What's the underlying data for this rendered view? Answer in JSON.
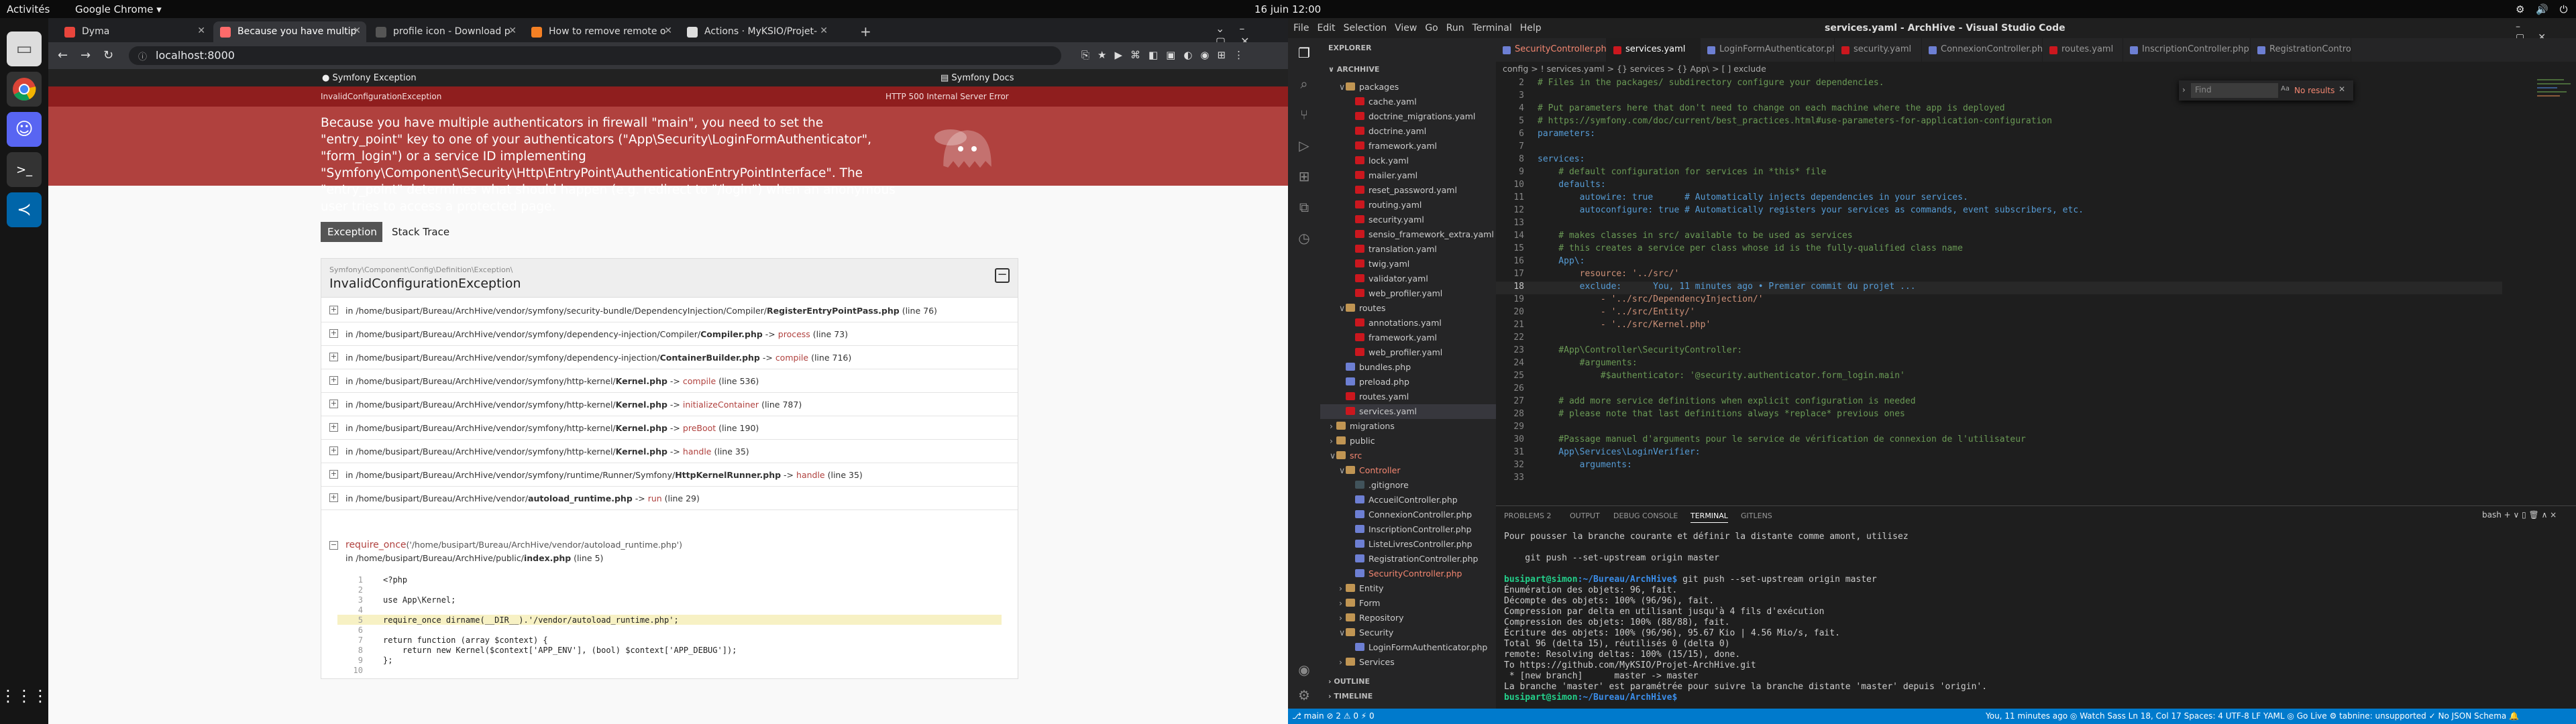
{
  "gnome": {
    "activities": "Activités",
    "app": "Google Chrome ▾",
    "clock": "16 juin  12:00"
  },
  "chrome": {
    "tabs": [
      {
        "label": "Dyma",
        "color": "#e8453c"
      },
      {
        "label": "Because you have multip",
        "color": "#ff6b6b"
      },
      {
        "label": "profile icon - Download p",
        "color": "#333"
      },
      {
        "label": "How to remove remote o",
        "color": "#f48024"
      },
      {
        "label": "Actions · MyKSIO/Projet-",
        "color": "#ddd"
      }
    ],
    "url": "localhost:8000"
  },
  "symfony": {
    "brand": "Symfony Exception",
    "docs": "Symfony Docs",
    "exception_short": "InvalidConfigurationException",
    "status": "HTTP 500 Internal Server Error",
    "message": "Because you have multiple authenticators in firewall \"main\", you need to set the \"entry_point\" key to one of your authenticators (\"App\\Security\\LoginFormAuthenticator\", \"form_login\") or a service ID implementing \"Symfony\\Component\\Security\\Http\\EntryPoint\\AuthenticationEntryPointInterface\". The \"entry_point\" determines what should happen (e.g. redirect to \"/login\") when an anonymous user tries to access a protected page.",
    "tab_exception": "Exception",
    "tab_trace": "Stack Trace",
    "namespace": "Symfony\\Component\\Config\\Definition\\Exception\\",
    "class": "InvalidConfigurationException",
    "toggle": "−",
    "trace": [
      {
        "path": "in /home/busipart/Bureau/ArchHive/vendor/symfony/security-bundle/DependencyInjection/Compiler/",
        "file": "RegisterEntryPointPass.php",
        "method": "",
        "line": "(line 76)"
      },
      {
        "path": "in /home/busipart/Bureau/ArchHive/vendor/symfony/dependency-injection/Compiler/",
        "file": "Compiler.php",
        "method": "process",
        "line": "(line 73)"
      },
      {
        "path": "in /home/busipart/Bureau/ArchHive/vendor/symfony/dependency-injection/",
        "file": "ContainerBuilder.php",
        "method": "compile",
        "line": "(line 716)"
      },
      {
        "path": "in /home/busipart/Bureau/ArchHive/vendor/symfony/http-kernel/",
        "file": "Kernel.php",
        "method": "compile",
        "line": "(line 536)"
      },
      {
        "path": "in /home/busipart/Bureau/ArchHive/vendor/symfony/http-kernel/",
        "file": "Kernel.php",
        "method": "initializeContainer",
        "line": "(line 787)"
      },
      {
        "path": "in /home/busipart/Bureau/ArchHive/vendor/symfony/http-kernel/",
        "file": "Kernel.php",
        "method": "preBoot",
        "line": "(line 190)"
      },
      {
        "path": "in /home/busipart/Bureau/ArchHive/vendor/symfony/http-kernel/",
        "file": "Kernel.php",
        "method": "handle",
        "line": "(line 35)"
      },
      {
        "path": "in /home/busipart/Bureau/ArchHive/vendor/symfony/runtime/Runner/Symfony/",
        "file": "HttpKernelRunner.php",
        "method": "handle",
        "line": "(line 35)"
      },
      {
        "path": "in /home/busipart/Bureau/ArchHive/vendor/",
        "file": "autoload_runtime.php",
        "method": "run",
        "line": "(line 29)"
      }
    ],
    "req_fn": "require_once",
    "req_arg": "('/home/busipart/Bureau/ArchHive/vendor/autoload_runtime.php')",
    "req_path": "in /home/busipart/Bureau/ArchHive/public/",
    "req_file": "index.php",
    "req_line": "(line 5)",
    "code": [
      {
        "n": "1",
        "c": "<?php"
      },
      {
        "n": "2",
        "c": ""
      },
      {
        "n": "3",
        "c": "use App\\Kernel;"
      },
      {
        "n": "4",
        "c": ""
      },
      {
        "n": "5",
        "c": "require_once dirname(__DIR__).'/vendor/autoload_runtime.php';"
      },
      {
        "n": "6",
        "c": ""
      },
      {
        "n": "7",
        "c": "return function (array $context) {"
      },
      {
        "n": "8",
        "c": "    return new Kernel($context['APP_ENV'], (bool) $context['APP_DEBUG']);"
      },
      {
        "n": "9",
        "c": "};"
      },
      {
        "n": "10",
        "c": ""
      }
    ]
  },
  "vscode": {
    "menu": [
      "File",
      "Edit",
      "Selection",
      "View",
      "Go",
      "Run",
      "Terminal",
      "Help"
    ],
    "title": "services.yaml - ArchHive - Visual Studio Code",
    "explorer_title": "EXPLORER",
    "root": "ARCHHIVE",
    "tree": [
      {
        "label": "packages",
        "indent": 1,
        "type": "fol",
        "st": "open"
      },
      {
        "label": "cache.yaml",
        "indent": 2,
        "type": "yml"
      },
      {
        "label": "doctrine_migrations.yaml",
        "indent": 2,
        "type": "yml"
      },
      {
        "label": "doctrine.yaml",
        "indent": 2,
        "type": "yml"
      },
      {
        "label": "framework.yaml",
        "indent": 2,
        "type": "yml"
      },
      {
        "label": "lock.yaml",
        "indent": 2,
        "type": "yml"
      },
      {
        "label": "mailer.yaml",
        "indent": 2,
        "type": "yml"
      },
      {
        "label": "reset_password.yaml",
        "indent": 2,
        "type": "yml"
      },
      {
        "label": "routing.yaml",
        "indent": 2,
        "type": "yml"
      },
      {
        "label": "security.yaml",
        "indent": 2,
        "type": "yml"
      },
      {
        "label": "sensio_framework_extra.yaml",
        "indent": 2,
        "type": "yml"
      },
      {
        "label": "translation.yaml",
        "indent": 2,
        "type": "yml"
      },
      {
        "label": "twig.yaml",
        "indent": 2,
        "type": "yml"
      },
      {
        "label": "validator.yaml",
        "indent": 2,
        "type": "yml"
      },
      {
        "label": "web_profiler.yaml",
        "indent": 2,
        "type": "yml"
      },
      {
        "label": "routes",
        "indent": 1,
        "type": "fol",
        "st": "open"
      },
      {
        "label": "annotations.yaml",
        "indent": 2,
        "type": "yml"
      },
      {
        "label": "framework.yaml",
        "indent": 2,
        "type": "yml"
      },
      {
        "label": "web_profiler.yaml",
        "indent": 2,
        "type": "yml"
      },
      {
        "label": "bundles.php",
        "indent": 1,
        "type": "php"
      },
      {
        "label": "preload.php",
        "indent": 1,
        "type": "php"
      },
      {
        "label": "routes.yaml",
        "indent": 1,
        "type": "yml"
      },
      {
        "label": "services.yaml",
        "indent": 1,
        "type": "yml",
        "sel": true
      },
      {
        "label": "migrations",
        "indent": 0,
        "type": "fol",
        "st": "closed"
      },
      {
        "label": "public",
        "indent": 0,
        "type": "fol",
        "st": "closed"
      },
      {
        "label": "src",
        "indent": 0,
        "type": "fol",
        "st": "open",
        "cls": "err"
      },
      {
        "label": "Controller",
        "indent": 1,
        "type": "fol",
        "st": "open",
        "cls": "err"
      },
      {
        "label": ".gitignore",
        "indent": 2,
        "type": "git"
      },
      {
        "label": "AccueilController.php",
        "indent": 2,
        "type": "php"
      },
      {
        "label": "ConnexionController.php",
        "indent": 2,
        "type": "php"
      },
      {
        "label": "InscriptionController.php",
        "indent": 2,
        "type": "php"
      },
      {
        "label": "ListeLivresController.php",
        "indent": 2,
        "type": "php"
      },
      {
        "label": "RegistrationController.php",
        "indent": 2,
        "type": "php"
      },
      {
        "label": "SecurityController.php",
        "indent": 2,
        "type": "php",
        "cls": "err"
      },
      {
        "label": "Entity",
        "indent": 1,
        "type": "fol",
        "st": "closed"
      },
      {
        "label": "Form",
        "indent": 1,
        "type": "fol",
        "st": "closed"
      },
      {
        "label": "Repository",
        "indent": 1,
        "type": "fol",
        "st": "closed"
      },
      {
        "label": "Security",
        "indent": 1,
        "type": "fol",
        "st": "open"
      },
      {
        "label": "LoginFormAuthenticator.php",
        "indent": 2,
        "type": "php"
      },
      {
        "label": "Services",
        "indent": 1,
        "type": "fol",
        "st": "closed"
      }
    ],
    "outline": "OUTLINE",
    "timeline": "TIMELINE",
    "tabs": [
      {
        "label": "SecurityController.php 2",
        "type": "php",
        "active": false
      },
      {
        "label": "services.yaml",
        "type": "yml",
        "active": true
      },
      {
        "label": "LoginFormAuthenticator.php",
        "type": "php",
        "active": false
      },
      {
        "label": "security.yaml",
        "type": "yml",
        "active": false
      },
      {
        "label": "ConnexionController.php",
        "type": "php",
        "active": false
      },
      {
        "label": "routes.yaml",
        "type": "yml",
        "active": false
      },
      {
        "label": "InscriptionController.php",
        "type": "php",
        "active": false
      },
      {
        "label": "RegistrationControlle",
        "type": "php",
        "active": false
      }
    ],
    "breadcrumb": "config > ! services.yaml > {} services > {} App\\ > [ ] exclude",
    "find": {
      "placeholder": "Find",
      "result": "No results"
    },
    "code": [
      {
        "n": "2",
        "c": "# Files in the packages/ subdirectory configure your dependencies.",
        "k": "cm"
      },
      {
        "n": "3",
        "c": "",
        "k": ""
      },
      {
        "n": "4",
        "c": "# Put parameters here that don't need to change on each machine where the app is deployed",
        "k": "cm"
      },
      {
        "n": "5",
        "c": "# https://symfony.com/doc/current/best_practices.html#use-parameters-for-application-configuration",
        "k": "cm"
      },
      {
        "n": "6",
        "c": "parameters:",
        "k": "ky"
      },
      {
        "n": "7",
        "c": "",
        "k": ""
      },
      {
        "n": "8",
        "c": "services:",
        "k": "ky"
      },
      {
        "n": "9",
        "c": "    # default configuration for services in *this* file",
        "k": "cm"
      },
      {
        "n": "10",
        "c": "    defaults:",
        "k": "ky"
      },
      {
        "n": "11",
        "c": "        autowire: true      # Automatically injects dependencies in your services.",
        "k": "ky"
      },
      {
        "n": "12",
        "c": "        autoconfigure: true # Automatically registers your services as commands, event subscribers, etc.",
        "k": "ky"
      },
      {
        "n": "13",
        "c": "",
        "k": ""
      },
      {
        "n": "14",
        "c": "    # makes classes in src/ available to be used as services",
        "k": "cm"
      },
      {
        "n": "15",
        "c": "    # this creates a service per class whose id is the fully-qualified class name",
        "k": "cm"
      },
      {
        "n": "16",
        "c": "    App\\:",
        "k": "ky"
      },
      {
        "n": "17",
        "c": "        resource: '../src/'",
        "k": "st"
      },
      {
        "n": "18",
        "c": "        exclude:      You, 11 minutes ago • Premier commit du projet ...",
        "k": "ky",
        "cur": true
      },
      {
        "n": "19",
        "c": "            - '../src/DependencyInjection/'",
        "k": "st"
      },
      {
        "n": "20",
        "c": "            - '../src/Entity/'",
        "k": "st"
      },
      {
        "n": "21",
        "c": "            - '../src/Kernel.php'",
        "k": "st"
      },
      {
        "n": "22",
        "c": "",
        "k": ""
      },
      {
        "n": "23",
        "c": "    #App\\Controller\\SecurityController:",
        "k": "cm"
      },
      {
        "n": "24",
        "c": "        #arguments:",
        "k": "cm"
      },
      {
        "n": "25",
        "c": "            #$authenticator: '@security.authenticator.form_login.main'",
        "k": "cm"
      },
      {
        "n": "26",
        "c": "",
        "k": ""
      },
      {
        "n": "27",
        "c": "    # add more service definitions when explicit configuration is needed",
        "k": "cm"
      },
      {
        "n": "28",
        "c": "    # please note that last definitions always *replace* previous ones",
        "k": "cm"
      },
      {
        "n": "29",
        "c": "",
        "k": ""
      },
      {
        "n": "30",
        "c": "    #Passage manuel d'arguments pour le service de vérification de connexion de l'utilisateur",
        "k": "cm"
      },
      {
        "n": "31",
        "c": "    App\\Services\\LoginVerifier:",
        "k": "ky"
      },
      {
        "n": "32",
        "c": "        arguments:",
        "k": "ky"
      },
      {
        "n": "33",
        "c": "",
        "k": ""
      }
    ],
    "panel_tabs": [
      "PROBLEMS 2",
      "OUTPUT",
      "DEBUG CONSOLE",
      "TERMINAL",
      "GITLENS"
    ],
    "panel_right": "bash  + ∨  ▯  🗑  ∧  ×",
    "terminal": [
      {
        "t": "Pour pousser la branche courante et définir la distante comme amont, utilisez",
        "p": false
      },
      {
        "t": "",
        "p": false
      },
      {
        "t": "    git push --set-upstream origin master",
        "p": false
      },
      {
        "t": "",
        "p": false
      },
      {
        "t": " git push --set-upstream origin master",
        "p": true
      },
      {
        "t": "Énumération des objets: 96, fait.",
        "p": false
      },
      {
        "t": "Décompte des objets: 100% (96/96), fait.",
        "p": false
      },
      {
        "t": "Compression par delta en utilisant jusqu'à 4 fils d'exécution",
        "p": false
      },
      {
        "t": "Compression des objets: 100% (88/88), fait.",
        "p": false
      },
      {
        "t": "Écriture des objets: 100% (96/96), 95.67 Kio | 4.56 Mio/s, fait.",
        "p": false
      },
      {
        "t": "Total 96 (delta 15), réutilisés 0 (delta 0)",
        "p": false
      },
      {
        "t": "remote: Resolving deltas: 100% (15/15), done.",
        "p": false
      },
      {
        "t": "To https://github.com/MyKSIO/Projet-ArchHive.git",
        "p": false
      },
      {
        "t": " * [new branch]      master -> master",
        "p": false
      },
      {
        "t": "La branche 'master' est paramétrée pour suivre la branche distante 'master' depuis 'origin'.",
        "p": false
      },
      {
        "t": " ",
        "p": true
      }
    ],
    "prompt_user": "busipart@simon",
    "prompt_path": ":~/Bureau/ArchHive$",
    "status_left": "⎇ main   ⊘ 2 ⚠ 0   ⚡ 0",
    "status_right": "You, 11 minutes ago    ◎ Watch Sass    Ln 18, Col 17    Spaces: 4    UTF-8    LF    YAML    ◎ Go Live    ⚙ tabnine: unsupported    ✓ No JSON Schema    🔔"
  }
}
